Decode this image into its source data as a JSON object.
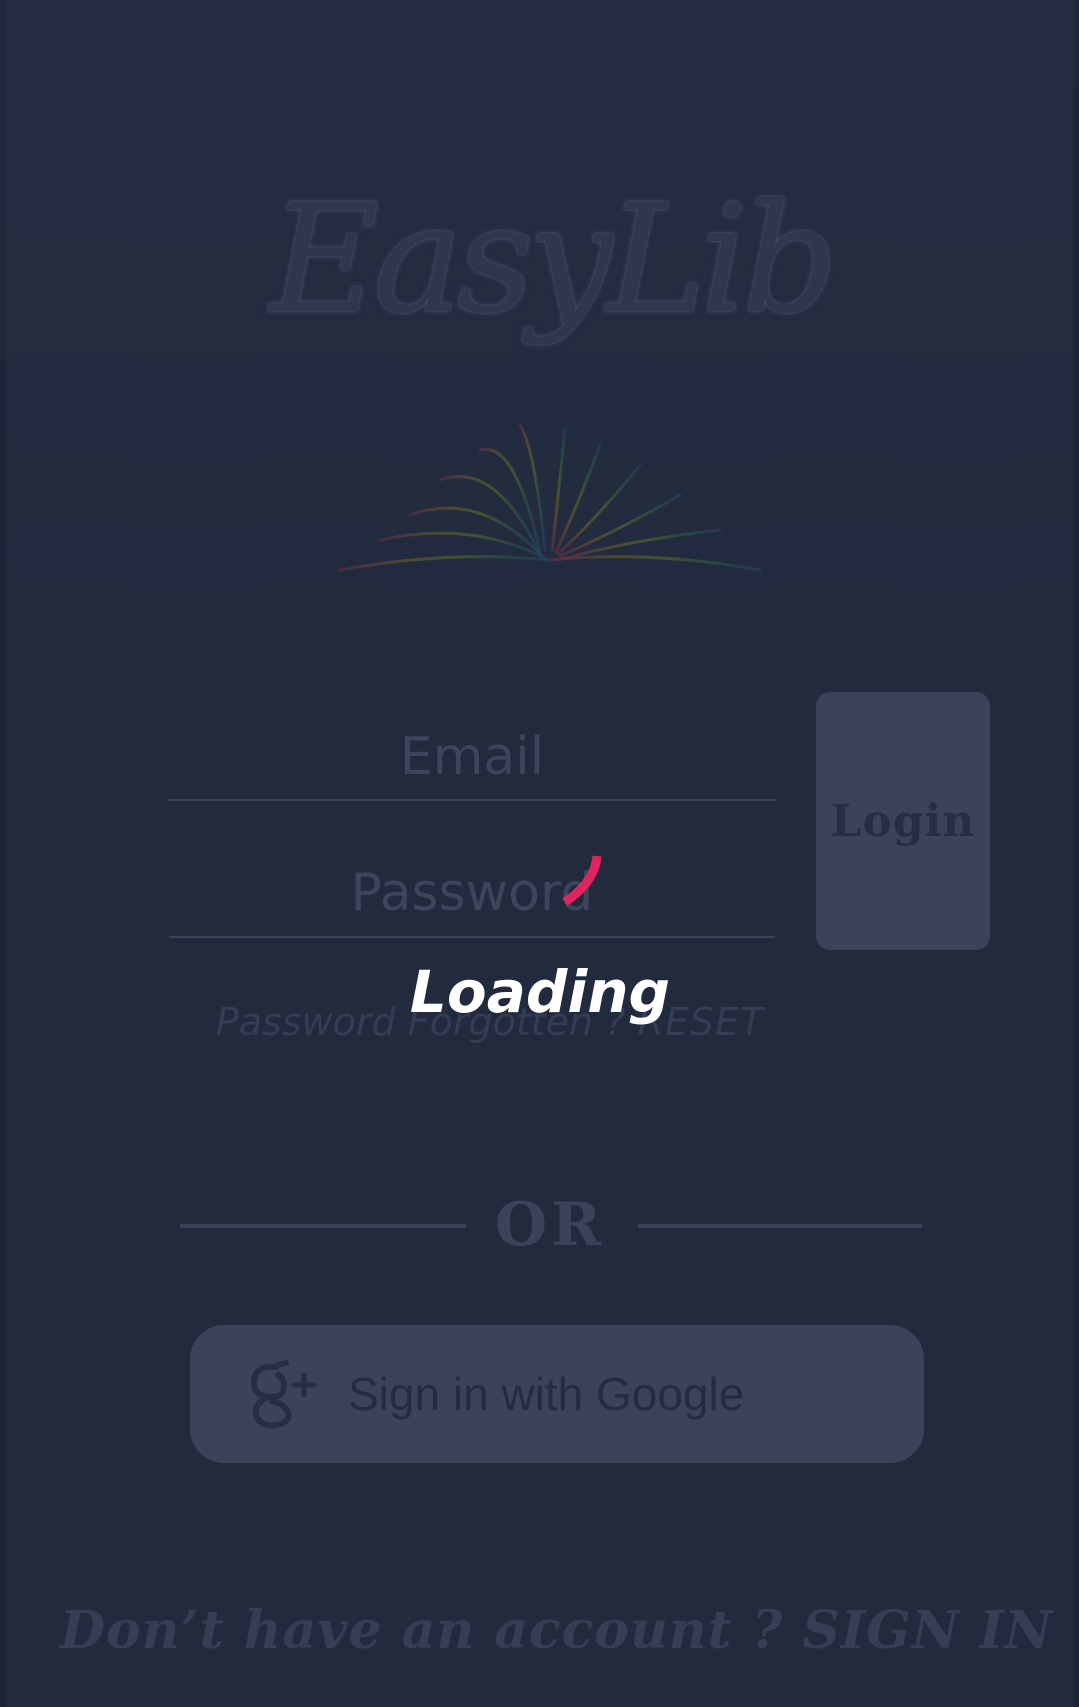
{
  "app": {
    "logo_text": "EasyLib"
  },
  "login_form": {
    "email_placeholder": "Email",
    "password_placeholder": "Password",
    "login_label": "Login",
    "forgot_text": "Password Forgotten ? ",
    "reset_label": "RESET"
  },
  "loading": {
    "label": "Loading",
    "spinner_color": "#e0245e"
  },
  "divider": {
    "label": "OR"
  },
  "google": {
    "label": "Sign in with Google",
    "icon": "google-plus-icon"
  },
  "footer": {
    "prompt": "Don’t have an account ? ",
    "signup_label": "SIGN IN"
  },
  "colors": {
    "background": "#222a3e",
    "muted": "#3a4358",
    "overlay_text": "#ffffff"
  }
}
